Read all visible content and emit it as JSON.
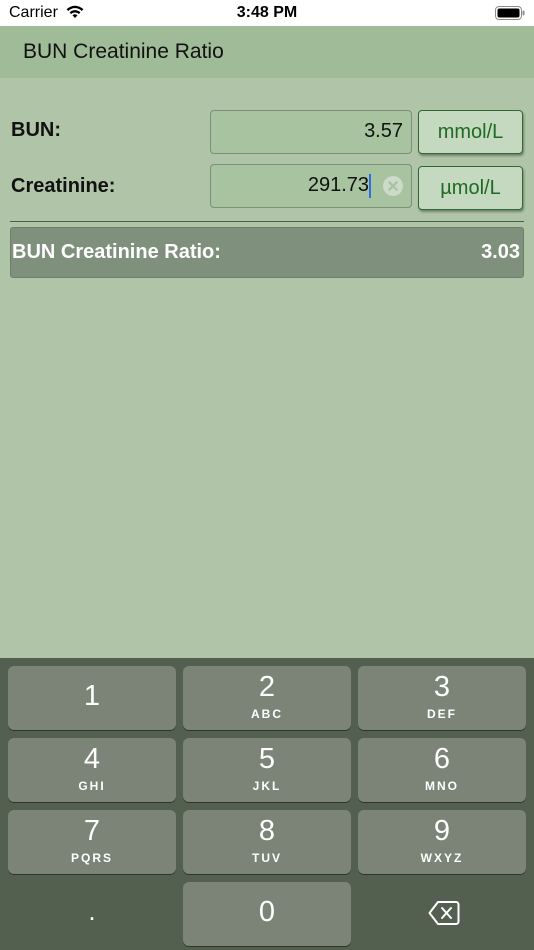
{
  "status_bar": {
    "carrier": "Carrier",
    "time": "3:48 PM"
  },
  "nav": {
    "title": "BUN Creatinine Ratio"
  },
  "form": {
    "bun": {
      "label": "BUN:",
      "value": "3.57",
      "unit": "mmol/L"
    },
    "creatinine": {
      "label": "Creatinine:",
      "value": "291.73",
      "unit": "µmol/L"
    }
  },
  "result": {
    "label": "BUN Creatinine Ratio:",
    "value": "3.03"
  },
  "keyboard": {
    "keys": [
      {
        "digit": "1",
        "letters": ""
      },
      {
        "digit": "2",
        "letters": "ABC"
      },
      {
        "digit": "3",
        "letters": "DEF"
      },
      {
        "digit": "4",
        "letters": "GHI"
      },
      {
        "digit": "5",
        "letters": "JKL"
      },
      {
        "digit": "6",
        "letters": "MNO"
      },
      {
        "digit": "7",
        "letters": "PQRS"
      },
      {
        "digit": "8",
        "letters": "TUV"
      },
      {
        "digit": "9",
        "letters": "WXYZ"
      }
    ],
    "dot": ".",
    "zero": "0"
  },
  "colors": {
    "background": "#b0c4a8",
    "navbar": "#9fbb98",
    "unit_text": "#1f6a24",
    "result_bar": "#7f917d",
    "keyboard": "#54604f",
    "key": "#7c8478",
    "cursor": "#2f6fe0"
  },
  "icons": [
    "wifi-icon",
    "battery-icon",
    "clear-text-icon",
    "backspace-icon"
  ]
}
